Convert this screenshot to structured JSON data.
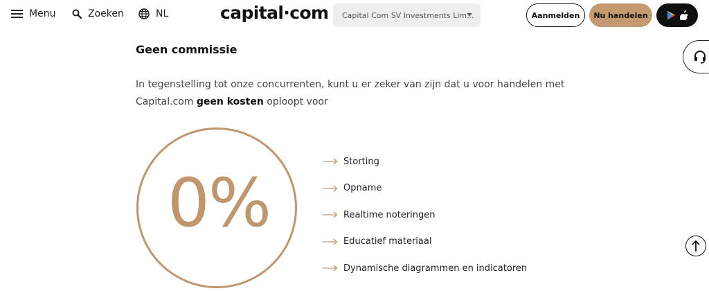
{
  "header": {
    "menu_label": "Menu",
    "search_label": "Zoeken",
    "language_label": "NL",
    "logo_text_left": "capital",
    "logo_text_right": "com",
    "entity_select": "Capital Com SV Investments Lim...",
    "login_label": "Aanmelden",
    "trade_label": "Nu handelen"
  },
  "section": {
    "title": "Geen commissie",
    "intro_before": "In tegenstelling tot onze concurrenten, kunt u er zeker van zijn dat u voor handelen met Capital.com ",
    "intro_bold": "geen kosten",
    "intro_after": " oploopt voor",
    "percentage": "0%",
    "features": [
      "Storting",
      "Opname",
      "Realtime noteringen",
      "Educatief materiaal",
      "Dynamische diagrammen en indicatoren"
    ]
  },
  "colors": {
    "accent": "#c0966c",
    "button_trade": "#c59a70",
    "text": "#111111"
  },
  "icons": [
    "menu-icon",
    "search-icon",
    "globe-icon",
    "caret-down-icon",
    "google-play-icon",
    "apple-icon",
    "headset-icon",
    "arrow-up-icon",
    "arrow-right-icon"
  ]
}
